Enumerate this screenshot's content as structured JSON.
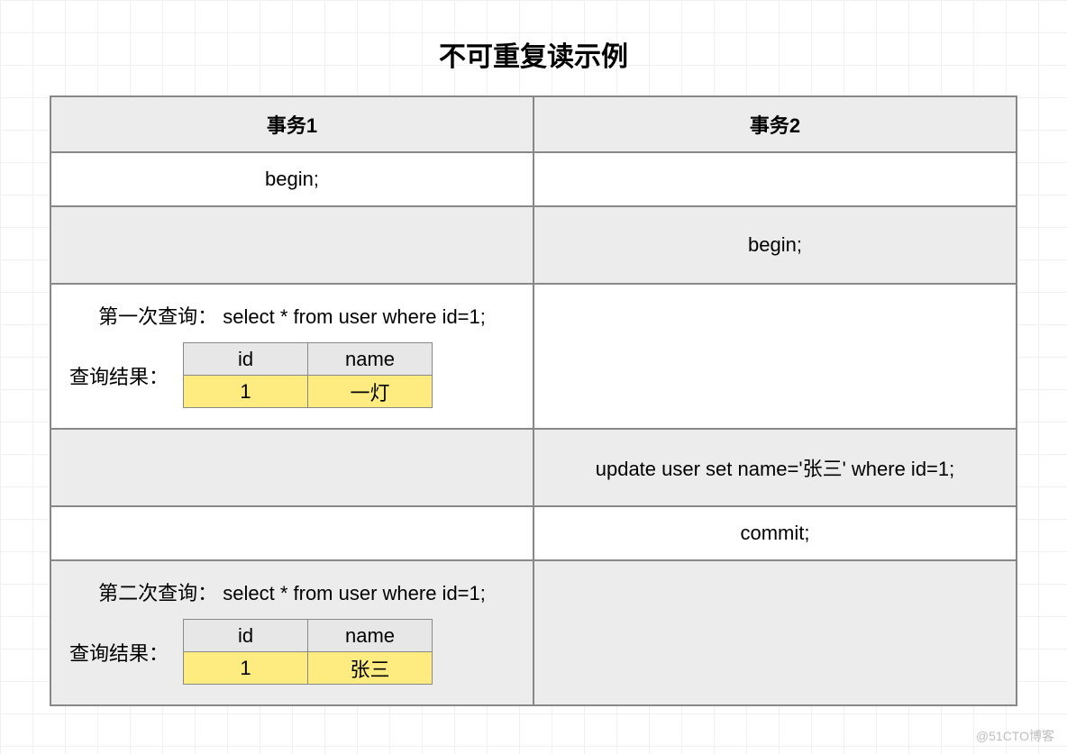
{
  "title": "不可重复读示例",
  "headers": {
    "col1": "事务1",
    "col2": "事务2"
  },
  "rows": {
    "r1": {
      "c1": "begin;",
      "c2": ""
    },
    "r2": {
      "c1": "",
      "c2": "begin;"
    },
    "r3": {
      "query_label": "第一次查询：",
      "sql": "select * from user where id=1;",
      "result_label": "查询结果：",
      "th1": "id",
      "th2": "name",
      "td1": "1",
      "td2": "一灯"
    },
    "r4": {
      "c1": "",
      "c2": "update user set name='张三' where id=1;"
    },
    "r5": {
      "c1": "",
      "c2": "commit;"
    },
    "r6": {
      "query_label": "第二次查询：",
      "sql": "select * from user where id=1;",
      "result_label": "查询结果：",
      "th1": "id",
      "th2": "name",
      "td1": "1",
      "td2": "张三"
    }
  },
  "watermark": "@51CTO博客"
}
